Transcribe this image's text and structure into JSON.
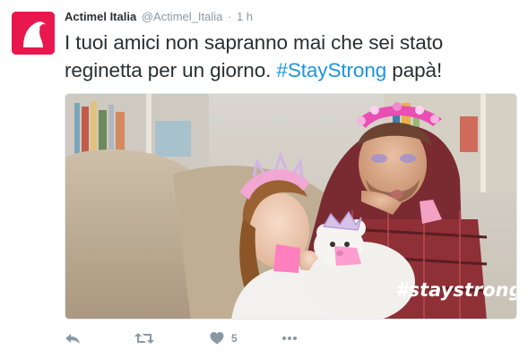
{
  "tweet": {
    "author_name": "Actimel Italia",
    "author_handle": "@Actimel_Italia",
    "separator": "·",
    "timestamp": "1 h",
    "text_before": "I tuoi amici non sapranno mai che sei stato reginetta per un giorno. ",
    "hashtag": "#StayStrong",
    "text_after": " papà!",
    "image_overlay_text": "#staystrong",
    "like_count": "5"
  },
  "icons": {
    "avatar": "actimel-logo-icon",
    "reply": "reply-icon",
    "retweet": "retweet-icon",
    "like": "heart-icon",
    "more": "more-icon"
  },
  "colors": {
    "brand": "#e8184e",
    "hashtag": "#1b95e0",
    "muted": "#8899a6",
    "text": "#292f33"
  }
}
